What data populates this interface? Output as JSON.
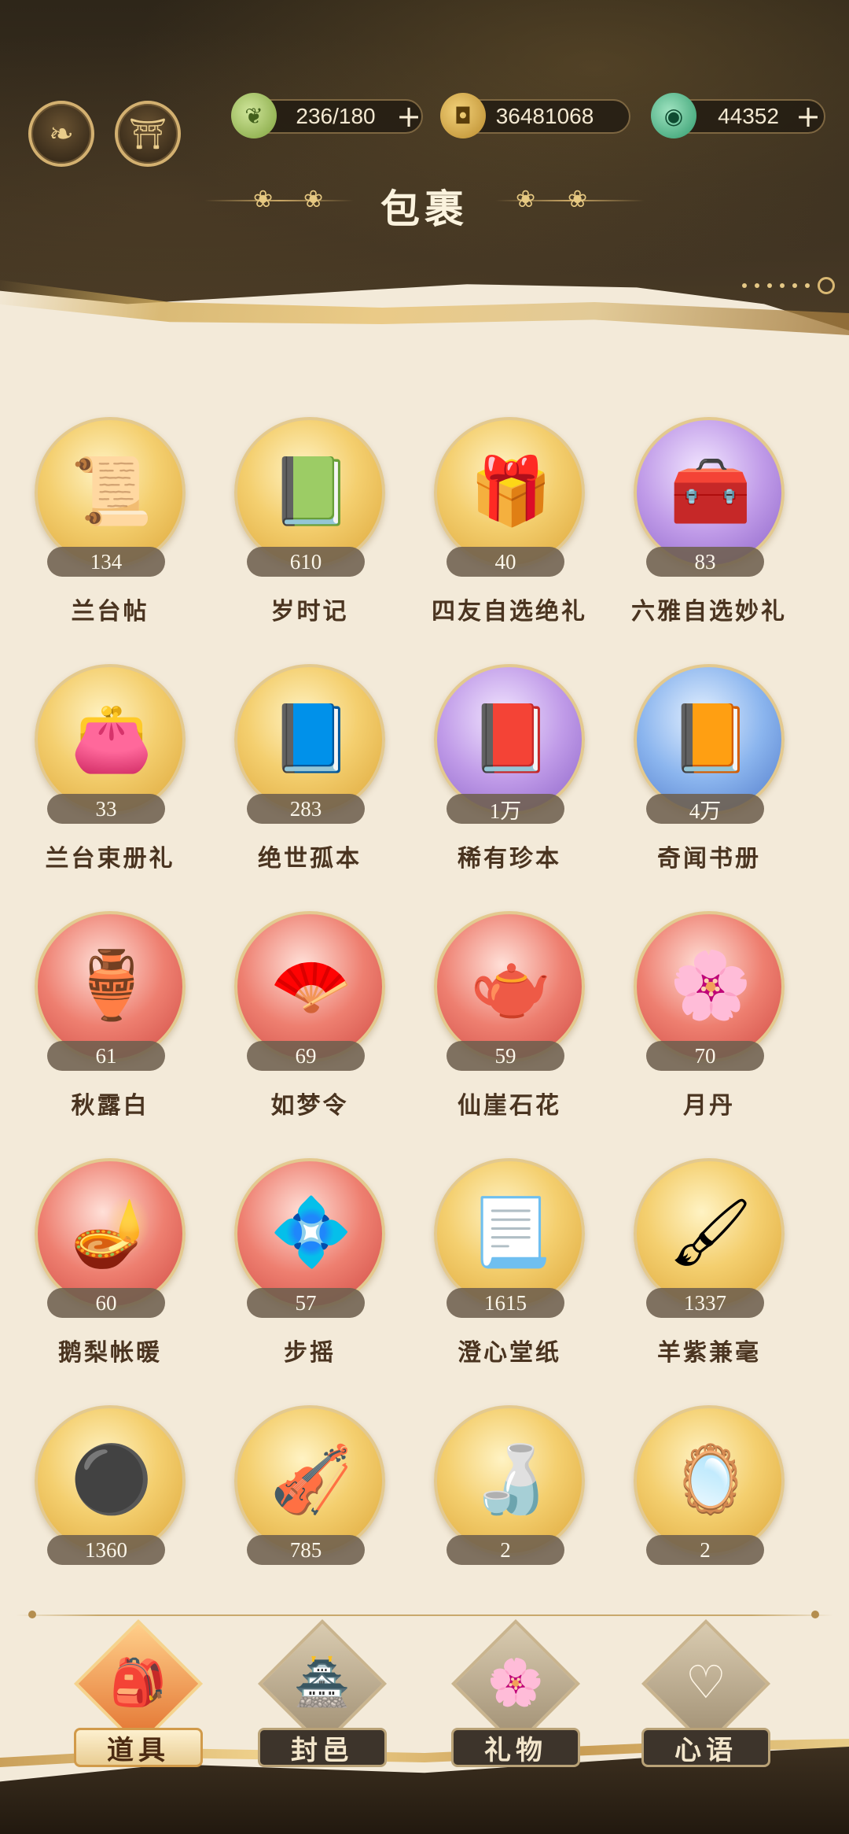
{
  "header": {
    "title": "包裹",
    "buttons": [
      {
        "name": "menu-emblem-button",
        "icon": "gold-leaf-emblem"
      },
      {
        "name": "pavilion-button",
        "icon": "pavilion-icon"
      }
    ],
    "resources": [
      {
        "icon": "leaf-stamina-icon",
        "value": "236/180",
        "has_plus": true
      },
      {
        "icon": "copper-coin-icon",
        "value": "36481068",
        "has_plus": false
      },
      {
        "icon": "jade-icon",
        "value": "44352",
        "has_plus": true
      }
    ],
    "plus_symbol": "+"
  },
  "items": [
    {
      "name": "兰台帖",
      "count": "134",
      "bg": "gold",
      "glyph": "📜"
    },
    {
      "name": "岁时记",
      "count": "610",
      "bg": "gold",
      "glyph": "📗"
    },
    {
      "name": "四友自选绝礼",
      "count": "40",
      "bg": "gold",
      "glyph": "🎁"
    },
    {
      "name": "六雅自选妙礼",
      "count": "83",
      "bg": "purple",
      "glyph": "🧰"
    },
    {
      "name": "兰台束册礼",
      "count": "33",
      "bg": "gold",
      "glyph": "👛"
    },
    {
      "name": "绝世孤本",
      "count": "283",
      "bg": "gold",
      "glyph": "📘"
    },
    {
      "name": "稀有珍本",
      "count": "1万",
      "bg": "purple",
      "glyph": "📕"
    },
    {
      "name": "奇闻书册",
      "count": "4万",
      "bg": "blue",
      "glyph": "📙"
    },
    {
      "name": "秋露白",
      "count": "61",
      "bg": "red",
      "glyph": "🏺"
    },
    {
      "name": "如梦令",
      "count": "69",
      "bg": "red",
      "glyph": "🪭"
    },
    {
      "name": "仙崖石花",
      "count": "59",
      "bg": "red",
      "glyph": "🫖"
    },
    {
      "name": "月丹",
      "count": "70",
      "bg": "red",
      "glyph": "🌸"
    },
    {
      "name": "鹅梨帐暖",
      "count": "60",
      "bg": "red",
      "glyph": "🪔"
    },
    {
      "name": "步摇",
      "count": "57",
      "bg": "red",
      "glyph": "💠"
    },
    {
      "name": "澄心堂纸",
      "count": "1615",
      "bg": "gold",
      "glyph": "📃"
    },
    {
      "name": "羊紫兼毫",
      "count": "1337",
      "bg": "gold",
      "glyph": "🖌"
    },
    {
      "name": "",
      "count": "1360",
      "bg": "gold",
      "glyph": "⚫"
    },
    {
      "name": "",
      "count": "785",
      "bg": "gold",
      "glyph": "🎻"
    },
    {
      "name": "",
      "count": "2",
      "bg": "gold",
      "glyph": "🍶"
    },
    {
      "name": "",
      "count": "2",
      "bg": "gold",
      "glyph": "🪞"
    }
  ],
  "bottom_nav": [
    {
      "label": "道具",
      "icon": "treasure-chest-icon",
      "glyph": "🎒",
      "active": true
    },
    {
      "label": "封邑",
      "icon": "palace-icon",
      "glyph": "🏯",
      "active": false
    },
    {
      "label": "礼物",
      "icon": "fan-flower-icon",
      "glyph": "🌸",
      "active": false
    },
    {
      "label": "心语",
      "icon": "heart-knot-icon",
      "glyph": "♡",
      "active": false
    }
  ],
  "colors": {
    "header_dark": "#2e2619",
    "gold_accent": "#d9b873",
    "page_bg": "#f3ead9",
    "item_name": "#4a3420",
    "count_pill": "#6e604e",
    "active_tab": "#e2712e"
  }
}
